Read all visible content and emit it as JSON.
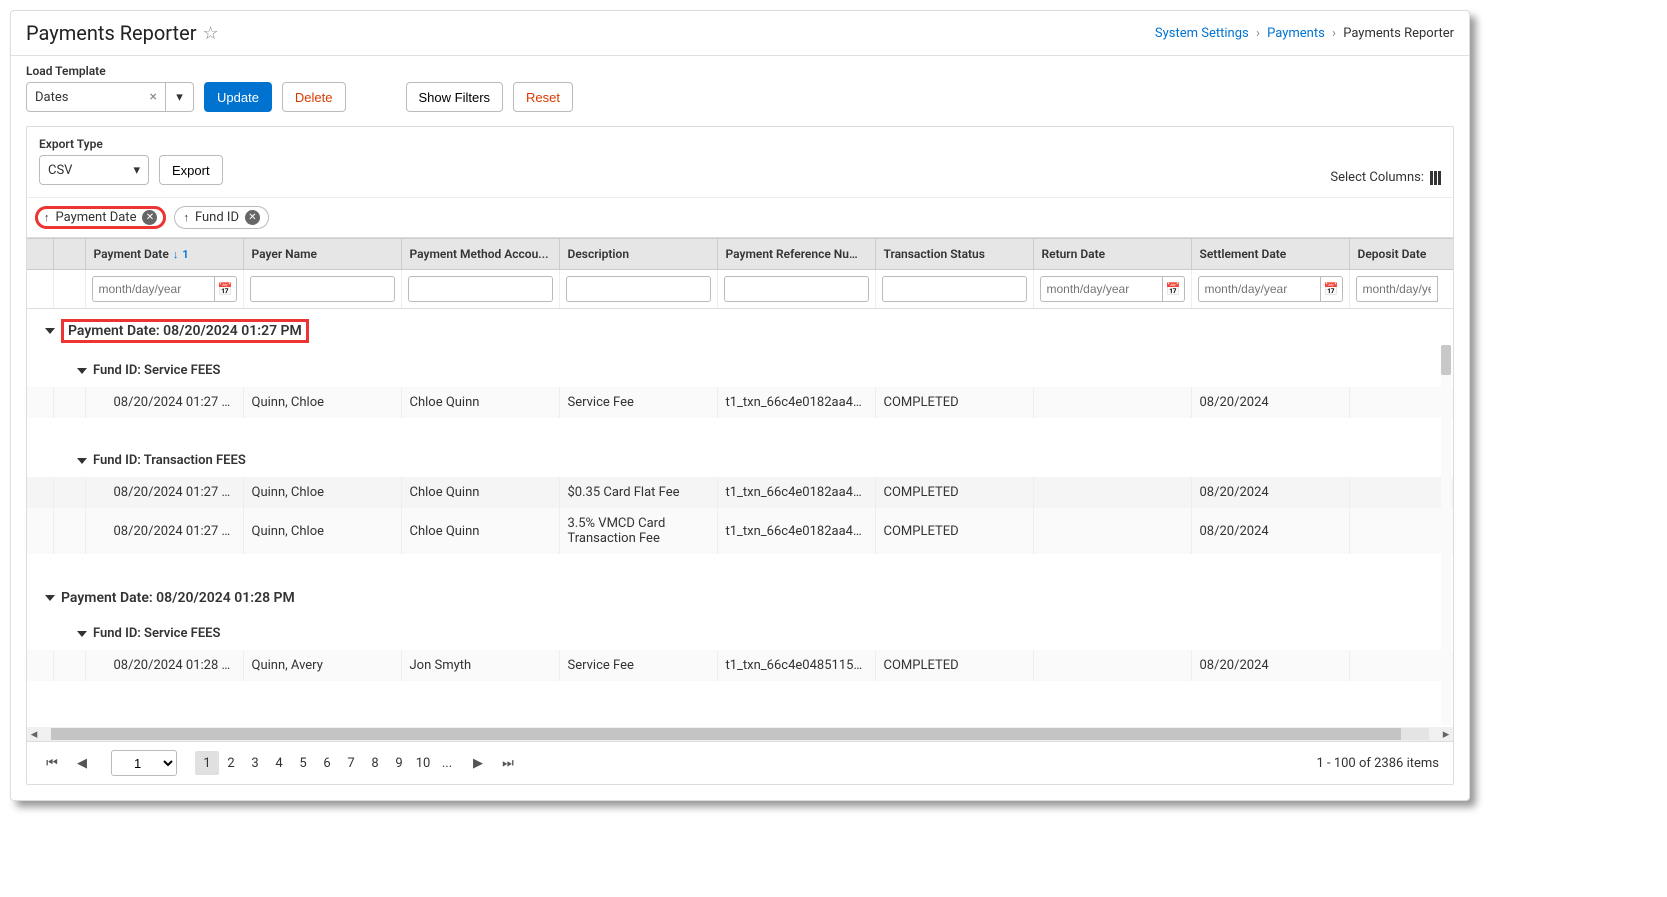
{
  "title": "Payments Reporter",
  "breadcrumb": {
    "a": "System Settings",
    "b": "Payments",
    "c": "Payments Reporter"
  },
  "loadTemplate": {
    "label": "Load Template",
    "value": "Dates"
  },
  "buttons": {
    "update": "Update",
    "delete": "Delete",
    "showFilters": "Show Filters",
    "reset": "Reset",
    "export": "Export"
  },
  "exportType": {
    "label": "Export Type",
    "value": "CSV"
  },
  "selectColumns": "Select Columns:",
  "chips": {
    "paymentDate": "Payment Date",
    "fundId": "Fund ID"
  },
  "headers": {
    "paymentDate": "Payment Date",
    "payerName": "Payer Name",
    "paymentMethod": "Payment Method Accou...",
    "description": "Description",
    "paymentRef": "Payment Reference Num...",
    "txnStatus": "Transaction Status",
    "returnDate": "Return Date",
    "settlementDate": "Settlement Date",
    "depositDate": "Deposit Date",
    "sortIndex": "1"
  },
  "placeholders": {
    "date": "month/day/year"
  },
  "groups": [
    {
      "label": "Payment Date: 08/20/2024 01:27 PM",
      "highlighted": true,
      "subgroups": [
        {
          "label": "Fund ID: Service FEES",
          "rows": [
            {
              "paymentDate": "08/20/2024 01:27 PM",
              "payerName": "Quinn, Chloe",
              "paymentMethod": "Chloe Quinn",
              "description": "Service Fee",
              "paymentRef": "t1_txn_66c4e0182aa44...",
              "txnStatus": "COMPLETED",
              "returnDate": "",
              "settlementDate": "08/20/2024",
              "depositDate": ""
            }
          ]
        },
        {
          "label": "Fund ID: Transaction FEES",
          "rows": [
            {
              "paymentDate": "08/20/2024 01:27 PM",
              "payerName": "Quinn, Chloe",
              "paymentMethod": "Chloe Quinn",
              "description": "$0.35 Card Flat Fee",
              "paymentRef": "t1_txn_66c4e0182aa44...",
              "txnStatus": "COMPLETED",
              "returnDate": "",
              "settlementDate": "08/20/2024",
              "depositDate": ""
            },
            {
              "paymentDate": "08/20/2024 01:27 PM",
              "payerName": "Quinn, Chloe",
              "paymentMethod": "Chloe Quinn",
              "description": "3.5% VMCD Card Transaction Fee",
              "paymentRef": "t1_txn_66c4e0182aa44...",
              "txnStatus": "COMPLETED",
              "returnDate": "",
              "settlementDate": "08/20/2024",
              "depositDate": ""
            }
          ]
        }
      ]
    },
    {
      "label": "Payment Date: 08/20/2024 01:28 PM",
      "highlighted": false,
      "subgroups": [
        {
          "label": "Fund ID: Service FEES",
          "rows": [
            {
              "paymentDate": "08/20/2024 01:28 PM",
              "payerName": "Quinn, Avery",
              "paymentMethod": "Jon Smyth",
              "description": "Service Fee",
              "paymentRef": "t1_txn_66c4e04851157...",
              "txnStatus": "COMPLETED",
              "returnDate": "",
              "settlementDate": "08/20/2024",
              "depositDate": ""
            }
          ]
        }
      ]
    }
  ],
  "pager": {
    "pages": [
      "1",
      "2",
      "3",
      "4",
      "5",
      "6",
      "7",
      "8",
      "9",
      "10",
      "..."
    ],
    "status": "1 - 100 of 2386 items",
    "selected": "1"
  }
}
